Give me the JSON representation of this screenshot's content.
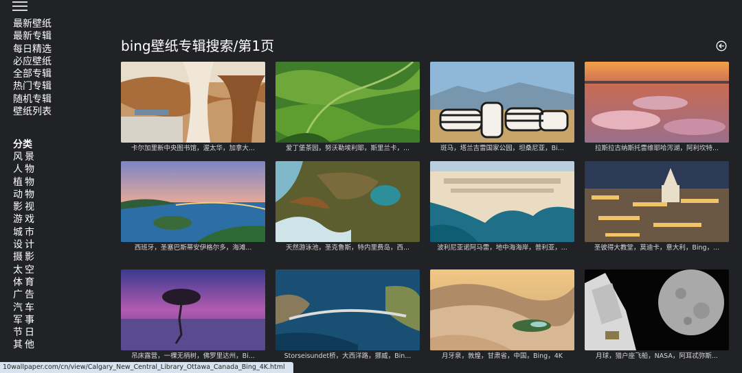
{
  "page": {
    "title": "bing壁纸专辑搜索/第1页"
  },
  "sidebar": {
    "nav_items": [
      "最新壁纸",
      "最新专辑",
      "每日精选",
      "必应壁纸",
      "全部专辑",
      "热门专辑",
      "随机专辑",
      "壁纸列表"
    ],
    "category_title": "分类",
    "categories": [
      "风景",
      "人物",
      "植物",
      "动物",
      "影视",
      "游戏",
      "城市",
      "设计",
      "摄影",
      "太空",
      "体育",
      "广告",
      "汽车",
      "军事",
      "节日",
      "其他"
    ]
  },
  "gallery": {
    "items": [
      {
        "caption": "卡尔加里新中央图书馆，渥太华，加拿大..."
      },
      {
        "caption": "爱丁堡茶园，努沃勒埃利耶，斯里兰卡，..."
      },
      {
        "caption": "斑马，塔兰吉雷国家公园，坦桑尼亚，Bi..."
      },
      {
        "caption": "拉斯拉古纳斯托雷维耶哈泻湖，阿利坎特..."
      },
      {
        "caption": "西班牙，圣塞巴斯蒂安伊格尔多，海滩..."
      },
      {
        "caption": "天然游泳池，圣克鲁斯，特内里费岛，西..."
      },
      {
        "caption": "波利尼亚诺阿马雷，地中海海岸，普利亚，..."
      },
      {
        "caption": "圣彼得大教堂，莫迪卡，意大利，Bing，..."
      },
      {
        "caption": "吊床露营，一棵无柄树，佛罗里达州，Bi..."
      },
      {
        "caption": "Storseisundet桥，大西洋路，挪威，Bin..."
      },
      {
        "caption": "月牙泉，敦煌，甘肃省，中国，Bing，4K"
      },
      {
        "caption": "月球，猎户座飞船，NASA，阿耳忒弥斯..."
      }
    ]
  },
  "status_bar": {
    "url": "10wallpaper.com/cn/view/Calgary_New_Central_Library_Ottawa_Canada_Bing_4K.html"
  }
}
